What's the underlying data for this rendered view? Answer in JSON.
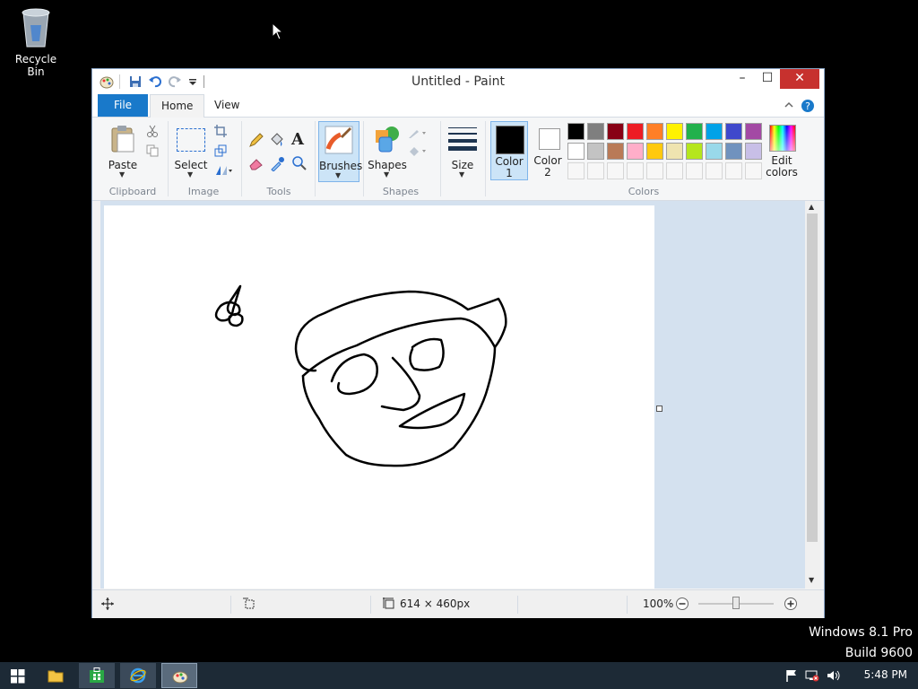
{
  "desktop": {
    "recycle_bin_label": "Recycle Bin",
    "watermark_line1": "Windows 8.1 Pro",
    "watermark_line2": "Build 9600"
  },
  "window": {
    "title": "Untitled - Paint",
    "controls": {
      "minimize": "–",
      "maximize": "☐",
      "close": "✕"
    }
  },
  "tabs": {
    "file": "File",
    "home": "Home",
    "view": "View"
  },
  "ribbon": {
    "paste": "Paste",
    "select": "Select",
    "brushes": "Brushes",
    "shapes": "Shapes",
    "size": "Size",
    "color1": "Color 1",
    "color2": "Color 2",
    "edit_colors": "Edit colors",
    "groups": {
      "clipboard": "Clipboard",
      "image": "Image",
      "tools": "Tools",
      "shapes": "Shapes",
      "colors": "Colors"
    },
    "color1_value": "#000000",
    "color2_value": "#ffffff",
    "palette_row1": [
      "#000000",
      "#7f7f7f",
      "#880015",
      "#ed1c24",
      "#ff7f27",
      "#fff200",
      "#22b14c",
      "#00a2e8",
      "#3f48cc",
      "#a349a4"
    ],
    "palette_row2": [
      "#ffffff",
      "#c3c3c3",
      "#b97a57",
      "#ffaec9",
      "#ffc90e",
      "#efe4b0",
      "#b5e61d",
      "#99d9ea",
      "#7092be",
      "#c8bfe7"
    ]
  },
  "statusbar": {
    "dimensions": "614 × 460px",
    "zoom": "100%",
    "zoom_slider_fraction": 0.5
  },
  "taskbar": {
    "clock": "5:48 PM"
  }
}
